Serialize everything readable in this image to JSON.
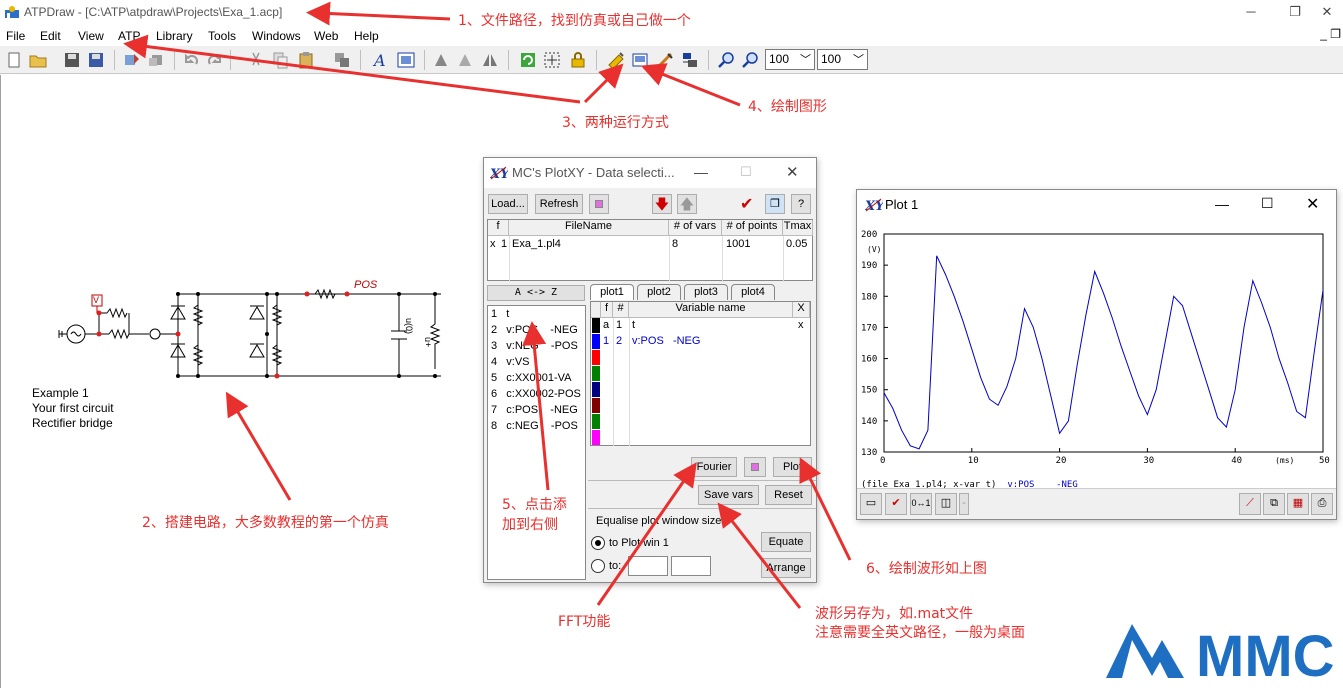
{
  "app": {
    "title": "ATPDraw - [C:\\ATP\\atpdraw\\Projects\\Exa_1.acp]",
    "menu": [
      "File",
      "Edit",
      "View",
      "ATP",
      "Library",
      "Tools",
      "Windows",
      "Web",
      "Help"
    ],
    "zoom1": "100",
    "zoom2": "100"
  },
  "circuit": {
    "labels": [
      "Example 1",
      "Your first circuit",
      "Rectifier bridge"
    ],
    "node_pos": "POS",
    "probe_v": "V",
    "cap_label": "u(0)",
    "res_label": "u+"
  },
  "plotxy_dialog": {
    "title": "MC's PlotXY - Data selecti...",
    "buttons": {
      "load": "Load...",
      "refresh": "Refresh",
      "help": "?",
      "az": "A <-> Z",
      "fourier": "Fourier",
      "plot": "Plot",
      "save_vars": "Save vars",
      "reset": "Reset",
      "equate": "Equate",
      "arrange": "Arrange"
    },
    "file_table": {
      "headers": [
        "f",
        "FileName",
        "# of vars",
        "# of points",
        "Tmax"
      ],
      "rows": [
        [
          "x",
          "1",
          "Exa_1.pl4",
          "8",
          "1001",
          "0.05"
        ]
      ]
    },
    "var_list": [
      [
        "1",
        "t"
      ],
      [
        "2",
        "v:POS    -NEG"
      ],
      [
        "3",
        "v:NEG    -POS"
      ],
      [
        "4",
        "v:VS"
      ],
      [
        "5",
        "c:XX0001-VA"
      ],
      [
        "6",
        "c:XX0002-POS"
      ],
      [
        "7",
        "c:POS    -NEG"
      ],
      [
        "8",
        "c:NEG    -POS"
      ]
    ],
    "tabs": [
      "plot1",
      "plot2",
      "plot3",
      "plot4"
    ],
    "plot_table": {
      "headers": [
        "f",
        "#",
        "Variable name",
        "X"
      ],
      "rows": [
        [
          "a",
          "1",
          "t",
          "x"
        ],
        [
          "1",
          "2",
          "v:POS   -NEG",
          ""
        ]
      ]
    },
    "swatch_colors": [
      "#000000",
      "#0000ff",
      "#ff0000",
      "#008000",
      "#000080",
      "#800000",
      "#008000",
      "#ff00ff"
    ],
    "equalise_label": "Equalise plot window sizes",
    "radio1": "to Plot win 1",
    "radio2": "to:"
  },
  "plot_window": {
    "title": "Plot 1",
    "y_ticks": [
      "200",
      "190",
      "180",
      "170",
      "160",
      "150",
      "140",
      "130"
    ],
    "y_unit": "(V)",
    "x_ticks": [
      "0",
      "10",
      "20",
      "30",
      "40",
      "50"
    ],
    "x_unit": "(ms)",
    "legend_file": "(file Exa_1.pl4; x-var t)",
    "legend_var": "v:POS    -NEG"
  },
  "chart_data": {
    "type": "line",
    "x": [
      0,
      1,
      2,
      3,
      4,
      5,
      6,
      7,
      8,
      9,
      10,
      11,
      12,
      13,
      14,
      15,
      16,
      17,
      18,
      19,
      20,
      21,
      22,
      23,
      24,
      25,
      26,
      27,
      28,
      29,
      30,
      31,
      32,
      33,
      34,
      35,
      36,
      37,
      38,
      39,
      40,
      41,
      42,
      43,
      44,
      45,
      46,
      47,
      48,
      49,
      50
    ],
    "series": [
      {
        "name": "v:POS    -NEG",
        "color": "#0000cc",
        "values": [
          149,
          144,
          137,
          132,
          131,
          137,
          193,
          187,
          180,
          172,
          163,
          154,
          147,
          145,
          151,
          160,
          176,
          170,
          160,
          148,
          136,
          140,
          158,
          174,
          188,
          181,
          173,
          164,
          156,
          148,
          142,
          150,
          165,
          180,
          177,
          168,
          159,
          150,
          141,
          138,
          150,
          170,
          185,
          178,
          170,
          160,
          152,
          143,
          141,
          162,
          182
        ]
      }
    ],
    "xlim": [
      0,
      50
    ],
    "ylim": [
      130,
      200
    ],
    "grid": false
  },
  "annotations": {
    "a1": "1、文件路径，找到仿真或自己做一个",
    "a2": "2、搭建电路，大多数教程的第一个仿真",
    "a3": "3、两种运行方式",
    "a4": "4、绘制图形",
    "a5a": "5、点击添",
    "a5b": "加到右侧",
    "a6": "6、绘制波形如上图",
    "a7": "FFT功能",
    "a8a": "波形另存为，如.mat文件",
    "a8b": "注意需要全英文路径，一般为桌面"
  },
  "watermark": "MMC"
}
